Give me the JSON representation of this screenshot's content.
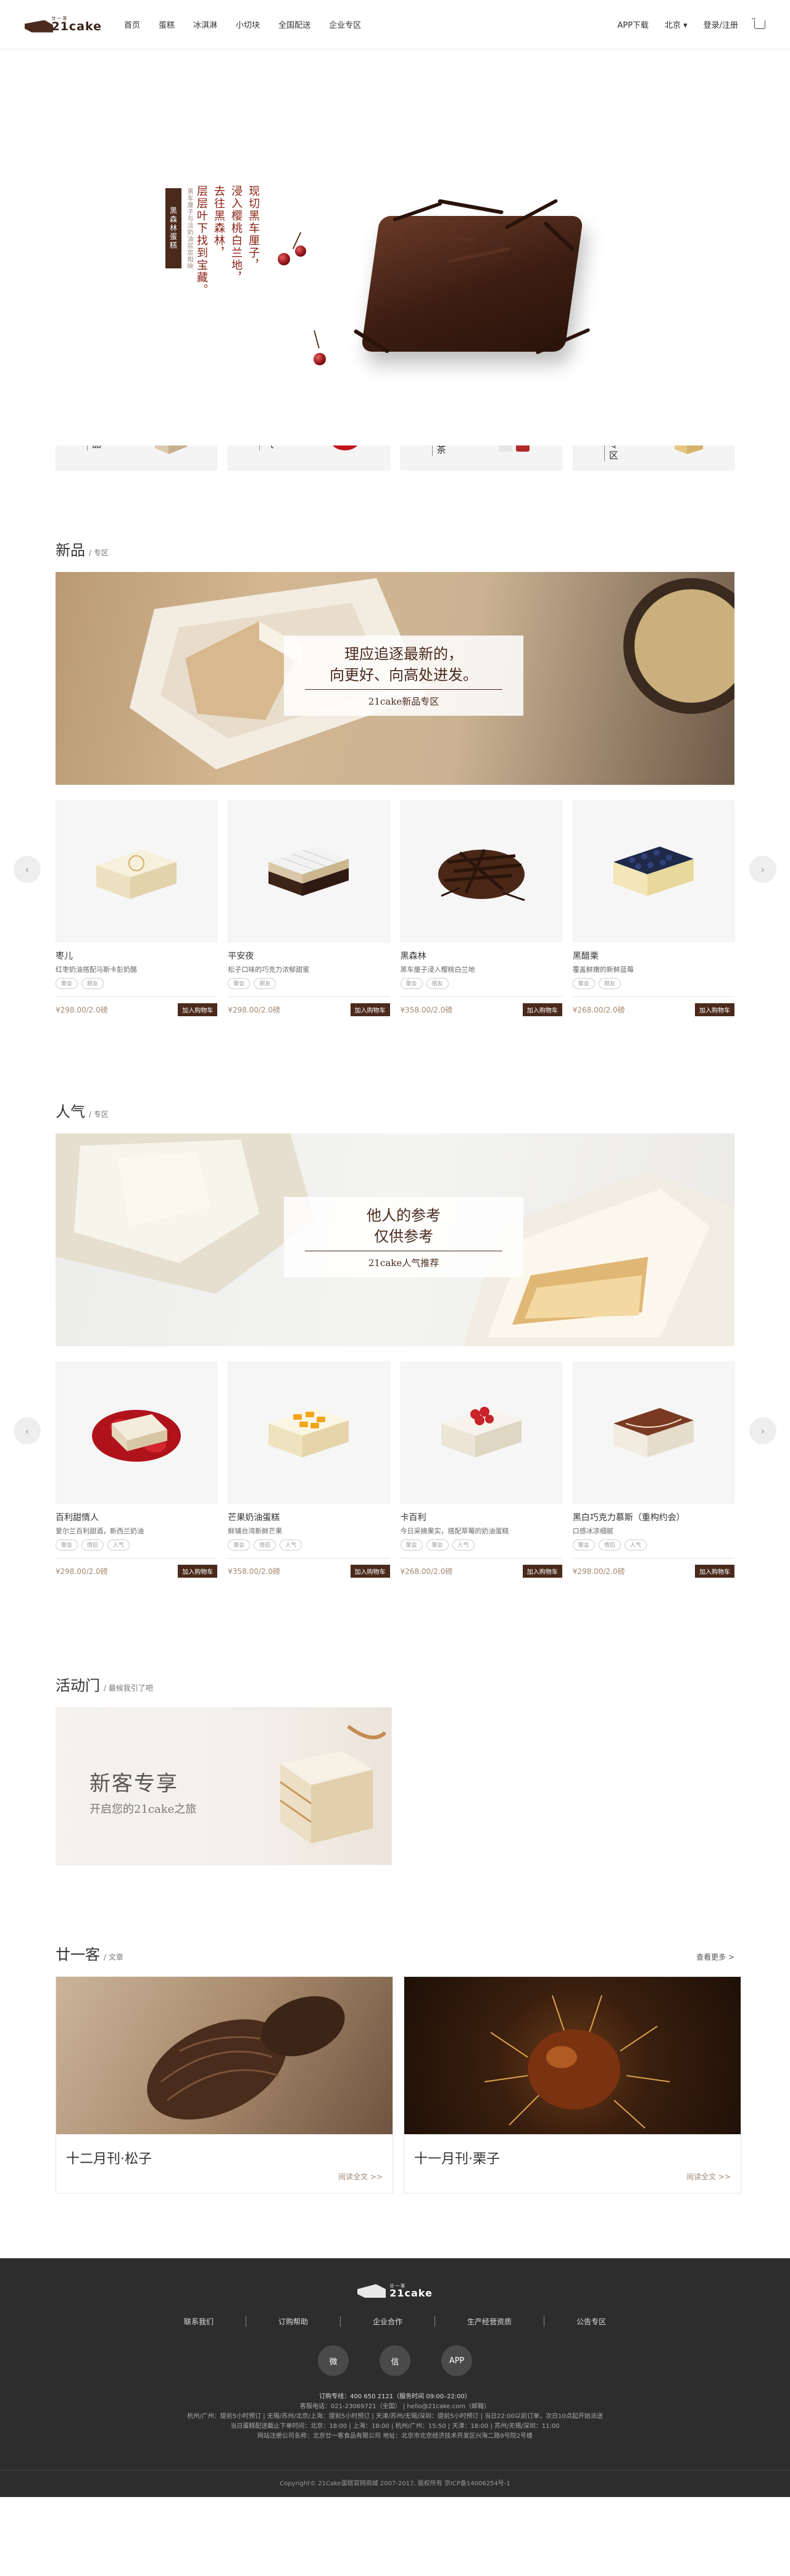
{
  "header": {
    "logo_small": "廿一客",
    "logo_text": "21cake",
    "nav": [
      "首页",
      "蛋糕",
      "冰淇淋",
      "小切块",
      "全国配送",
      "企业专区"
    ],
    "app_download": "APP下载",
    "city": "北京",
    "login": "登录/注册"
  },
  "hero": {
    "tag": "黑森林蛋糕",
    "subtitle": "黑车厘子与淡奶油层层相映",
    "title_lines": [
      "现切黑车厘子，",
      "浸入樱桃白兰地，",
      "去往黑森林，",
      "层层叶下找到宝藏。"
    ]
  },
  "categories": [
    {
      "label": "新品"
    },
    {
      "label": "人气"
    },
    {
      "label": "下午茶"
    },
    {
      "label": "活动专区"
    }
  ],
  "new_section": {
    "title": "新品",
    "sub": "/ 专区",
    "banner_line1": "理应追逐最新的，",
    "banner_line2": "向更好、向高处进发。",
    "banner_line3": "21cake新品专区",
    "products": [
      {
        "name": "枣儿",
        "desc": "红枣奶油搭配马斯卡彭奶酪",
        "tags": [
          "聚会",
          "朋友"
        ],
        "price": "¥298.00/2.0磅",
        "buy": "加入购物车"
      },
      {
        "name": "平安夜",
        "desc": "松子口味的巧克力浓郁甜蜜",
        "tags": [
          "聚会",
          "朋友"
        ],
        "price": "¥298.00/2.0磅",
        "buy": "加入购物车"
      },
      {
        "name": "黑森林",
        "desc": "黑车厘子浸入樱桃白兰地",
        "tags": [
          "聚会",
          "朋友"
        ],
        "price": "¥358.00/2.0磅",
        "buy": "加入购物车"
      },
      {
        "name": "黑醋栗",
        "desc": "覆盖鲜嫩的新鲜蓝莓",
        "tags": [
          "聚会",
          "朋友"
        ],
        "price": "¥268.00/2.0磅",
        "buy": "加入购物车"
      }
    ]
  },
  "popular_section": {
    "title": "人气",
    "sub": "/ 专区",
    "banner_line1": "他人的参考",
    "banner_line2": "仅供参考",
    "banner_line3": "21cake人气推荐",
    "products": [
      {
        "name": "百利甜情人",
        "desc": "爱尔兰百利甜酒，新西兰奶油",
        "tags": [
          "聚会",
          "情侣",
          "人气"
        ],
        "price": "¥298.00/2.0磅",
        "buy": "加入购物车"
      },
      {
        "name": "芒果奶油蛋糕",
        "desc": "鲜铺台湾新鲜芒果",
        "tags": [
          "聚会",
          "情侣",
          "人气"
        ],
        "price": "¥358.00/2.0磅",
        "buy": "加入购物车"
      },
      {
        "name": "卡百利",
        "desc": "今日采摘果实，搭配草莓的奶油蛋糕",
        "tags": [
          "聚会",
          "聚会",
          "人气"
        ],
        "price": "¥268.00/2.0磅",
        "buy": "加入购物车"
      },
      {
        "name": "黑白巧克力慕斯（重构约会）",
        "desc": "口感冰凉细腻",
        "tags": [
          "聚会",
          "情侣",
          "人气"
        ],
        "price": "¥298.00/2.0磅",
        "buy": "加入购物车"
      }
    ]
  },
  "activity_section": {
    "title": "活动门",
    "sub": "/ 最候我引了吧",
    "promo_line1": "新客专享",
    "promo_line2": "开启您的21cake之旅"
  },
  "article_section": {
    "title": "廿一客",
    "sub": "/ 文章",
    "more": "查看更多 >",
    "articles": [
      {
        "title": "十二月刊·松子",
        "more": "阅读全文 >>"
      },
      {
        "title": "十一月刊·栗子",
        "more": "阅读全文 >>"
      }
    ]
  },
  "footer": {
    "logo_small": "廿一客",
    "logo_text": "21cake",
    "links": [
      "联系我们",
      "订购帮助",
      "企业合作",
      "生产经营资质",
      "公告专区"
    ],
    "icons": [
      {
        "name": "weibo-icon",
        "label": "微"
      },
      {
        "name": "wechat-icon",
        "label": "信"
      },
      {
        "name": "app-icon",
        "label": "APP"
      }
    ],
    "hotline": "订购专线：400 650 2121（服务时间 09:00–22:00）",
    "info_line1": "客服电话：021-23069721（全国） | hello@21cake.com（邮箱）",
    "info_line2": "杭州/广州：提前5小时预订 | 无锡/苏州/北京/上海：提前5小时预订 | 天津/苏州/无锡/深圳：提前5小时预订 | 当日22:00以前订单，次日10点起开始派送",
    "info_line3": "当日蛋糕配送截止下单时间：北京：18:00 | 上海：18:00 | 杭州/广州：15:50 | 天津：18:00 | 苏州/无锡/深圳：11:00",
    "info_line4": "网站注册公司名称：北京廿一客食品有限公司  地址：北京市北京经济技术开发区兴海二路9号院2号楼",
    "copyright": "Copyright© 21Cake蛋糕官网商城 2007-2017, 版权所有 京ICP备14006254号-1"
  }
}
